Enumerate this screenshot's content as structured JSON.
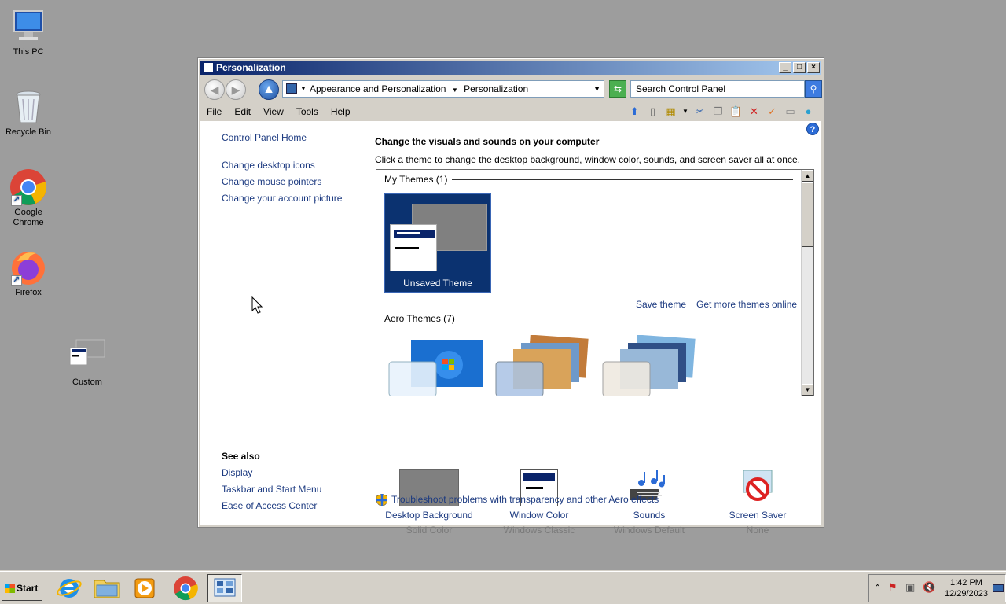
{
  "desktop": {
    "icons": [
      {
        "label": "This PC"
      },
      {
        "label": "Recycle Bin"
      },
      {
        "label": "Google Chrome"
      },
      {
        "label": "Firefox"
      },
      {
        "label": "Custom"
      }
    ]
  },
  "window": {
    "title": "Personalization",
    "address": {
      "crumb1": "Appearance and Personalization",
      "crumb2": "Personalization"
    },
    "search_placeholder": "Search Control Panel",
    "menu": [
      "File",
      "Edit",
      "View",
      "Tools",
      "Help"
    ]
  },
  "sidebar": {
    "home": "Control Panel Home",
    "links": [
      "Change desktop icons",
      "Change mouse pointers",
      "Change your account picture"
    ],
    "see_also_title": "See also",
    "see_also": [
      "Display",
      "Taskbar and Start Menu",
      "Ease of Access Center"
    ]
  },
  "main": {
    "heading": "Change the visuals and sounds on your computer",
    "subheading": "Click a theme to change the desktop background, window color, sounds, and screen saver all at once.",
    "my_themes_title": "My Themes (1)",
    "unsaved_theme": "Unsaved Theme",
    "save_theme": "Save theme",
    "get_more": "Get more themes online",
    "aero_title": "Aero Themes (7)",
    "settings": [
      {
        "title": "Desktop Background",
        "sub": "Solid Color"
      },
      {
        "title": "Window Color",
        "sub": "Windows Classic"
      },
      {
        "title": "Sounds",
        "sub": "Windows Default"
      },
      {
        "title": "Screen Saver",
        "sub": "None"
      }
    ],
    "troubleshoot": "Troubleshoot problems with transparency and other Aero effects"
  },
  "taskbar": {
    "start": "Start",
    "time": "1:42 PM",
    "date": "12/29/2023"
  },
  "colors": {
    "link": "#1c3a80",
    "title_start": "#0a246a",
    "title_end": "#a6caf0"
  }
}
